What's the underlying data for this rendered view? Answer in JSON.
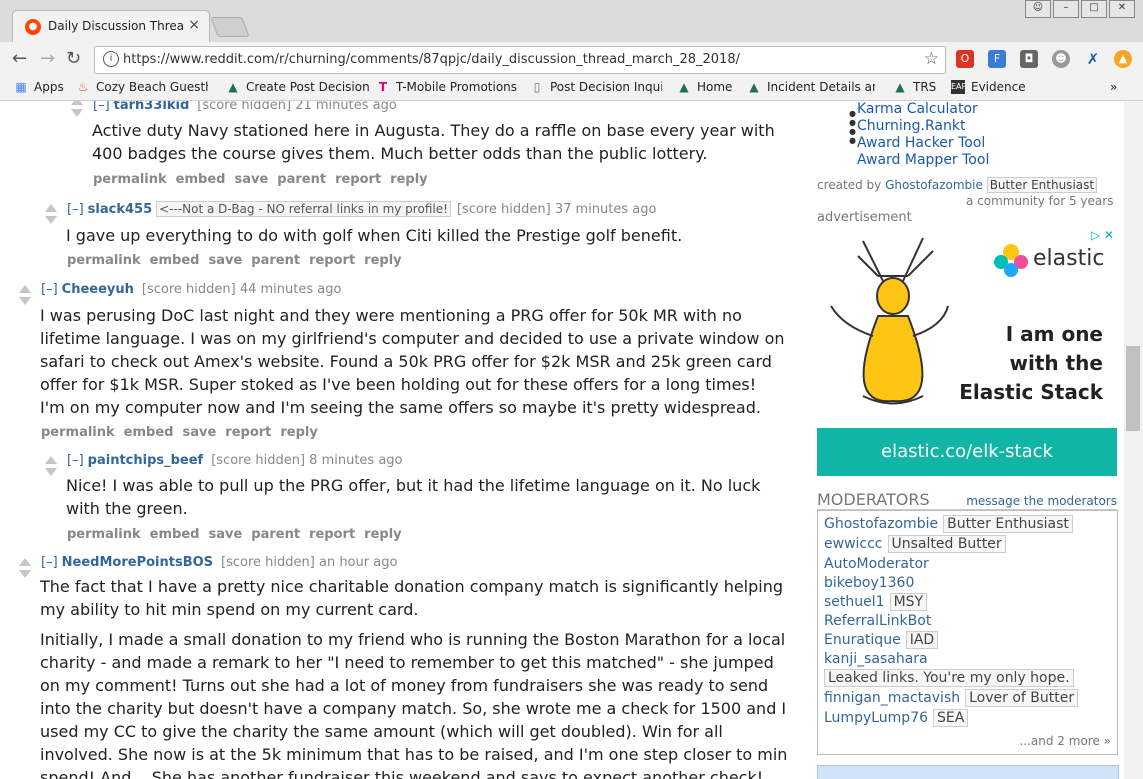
{
  "browser": {
    "tab_title": "Daily Discussion Thread",
    "tab_close": "×",
    "url": "https://www.reddit.com/r/churning/comments/87qpjc/daily_discussion_thread_march_28_2018/",
    "bookmarks": [
      "Apps",
      "Cozy Beach Guesthou",
      "Create Post Decision",
      "T-Mobile Promotions",
      "Post Decision Inquiry",
      "Home",
      "Incident Details and",
      "TRS",
      "Evidence"
    ],
    "bookmarks_more": "»"
  },
  "comments": [
    {
      "expand": "[–]",
      "author": "tarh33lkid",
      "flair": "",
      "score": "[score hidden]",
      "time": "21 minutes ago",
      "body": [
        "Active duty Navy stationed here in Augusta. They do a raffle on base every year with",
        "400 badges the course gives them. Much better odds than the public lottery."
      ],
      "actions": [
        "permalink",
        "embed",
        "save",
        "parent",
        "report",
        "reply"
      ]
    },
    {
      "expand": "[–]",
      "author": "slack455",
      "flair": "<---Not a D-Bag - NO referral links in my profile!",
      "score": "[score hidden]",
      "time": "37 minutes ago",
      "body": [
        "I gave up everything to do with golf when Citi killed the Prestige golf benefit."
      ],
      "actions": [
        "permalink",
        "embed",
        "save",
        "parent",
        "report",
        "reply"
      ]
    },
    {
      "expand": "[–]",
      "author": "Cheeeyuh",
      "flair": "",
      "score": "[score hidden]",
      "time": "44 minutes ago",
      "body": [
        "I was perusing DoC last night and they were mentioning a PRG offer for 50k MR with no",
        "lifetime language. I was on my girlfriend's computer and decided to use a private window on",
        "safari to check out Amex's website. Found a 50k PRG offer for $2k MSR and 25k green card",
        "offer for $1k MSR. Super stoked as I've been holding out for these offers for a long times!",
        "I'm on my computer now and I'm seeing the same offers so maybe it's pretty widespread."
      ],
      "actions": [
        "permalink",
        "embed",
        "save",
        "report",
        "reply"
      ]
    },
    {
      "expand": "[–]",
      "author": "paintchips_beef",
      "flair": "",
      "score": "[score hidden]",
      "time": "8 minutes ago",
      "body": [
        "Nice! I was able to pull up the PRG offer, but it had the lifetime language on it. No luck",
        "with the green."
      ],
      "actions": [
        "permalink",
        "embed",
        "save",
        "parent",
        "report",
        "reply"
      ]
    },
    {
      "expand": "[–]",
      "author": "NeedMorePointsBOS",
      "flair": "",
      "score": "[score hidden]",
      "time": "an hour ago",
      "body": [
        "The fact that I have a pretty nice charitable donation company match is significantly helping",
        "my ability to hit min spend on my current card."
      ],
      "body2": [
        "Initially, I made a small donation to my friend who is running the Boston Marathon for a local",
        "charity - and made a remark to her \"I need to remember to get this matched\" - she jumped",
        "on my comment! Turns out she had a lot of money from fundraisers she was ready to send",
        "into the charity but doesn't have a company match. So, she wrote me a check for 1500 and I",
        "used my CC to give the charity the same amount (which will get doubled). Win for all",
        "involved. She now is at the 5k minimum that has to be raised, and I'm one step closer to min",
        "spend! And... She has another fundraiser this weekend and says to expect another check!"
      ]
    }
  ],
  "sidebar": {
    "links": [
      "Karma Calculator",
      "Churning.Rankt",
      "Award Hacker Tool",
      "Award Mapper Tool"
    ],
    "created_by_label": "created by",
    "created_by_user": "Ghostofazombie",
    "created_by_flair": "Butter Enthusiast",
    "community_age": "a community for 5 years",
    "advertisement_label": "advertisement",
    "ad": {
      "brand": "elastic",
      "headline": [
        "I am one",
        "with the",
        "Elastic Stack"
      ],
      "cta": "elastic.co/elk-stack",
      "adchoices": "▷ ✕"
    },
    "moderators_title": "MODERATORS",
    "message_mods": "message the moderators",
    "moderators": [
      {
        "name": "Ghostofazombie",
        "flair": "Butter Enthusiast"
      },
      {
        "name": "ewwiccc",
        "flair": "Unsalted Butter"
      },
      {
        "name": "AutoModerator",
        "flair": ""
      },
      {
        "name": "bikeboy1360",
        "flair": ""
      },
      {
        "name": "sethuel1",
        "flair": "MSY"
      },
      {
        "name": "ReferralLinkBot",
        "flair": ""
      },
      {
        "name": "Enuratique",
        "flair": "IAD"
      },
      {
        "name": "kanji_sasahara",
        "flair": ""
      },
      {
        "name": "",
        "flair": "Leaked links. You're my only hope."
      },
      {
        "name": "finnigan_mactavish",
        "flair": "Lover of Butter"
      },
      {
        "name": "LumpyLump76",
        "flair": "SEA"
      }
    ],
    "more_mods": "...and 2 more »"
  }
}
